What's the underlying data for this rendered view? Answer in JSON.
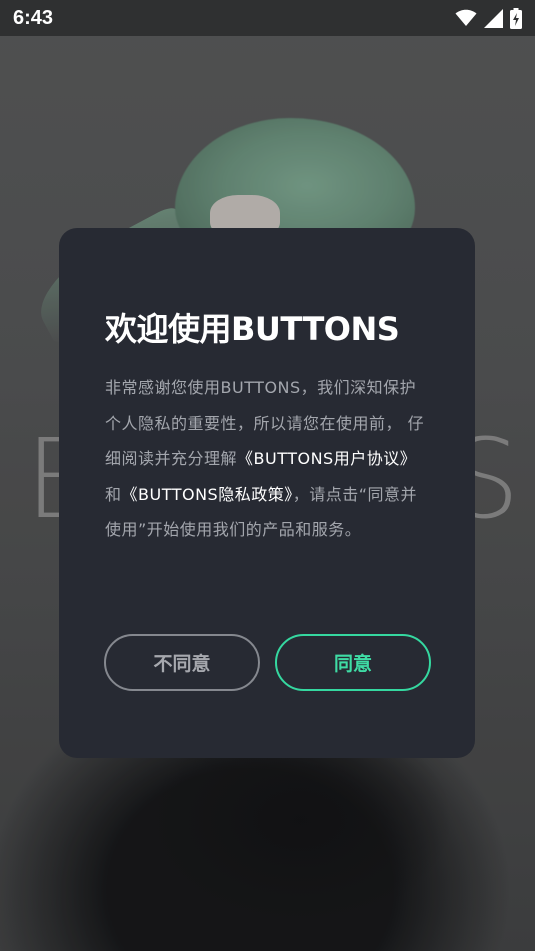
{
  "status_bar": {
    "time": "6:43",
    "icons": [
      "wifi-icon",
      "cellular-signal-icon",
      "battery-charging-icon"
    ]
  },
  "background": {
    "brand_letter_left": "B",
    "brand_letter_right": "S"
  },
  "dialog": {
    "title": "欢迎使用BUTTONS",
    "body": {
      "part1": "非常感谢您使用BUTTONS，我们深知保护个人隐私的重要性，所以请您在使用前， 仔细阅读并充分理解",
      "user_agreement_link": "《BUTTONS用户协议》",
      "connector": "和",
      "privacy_policy_link": "《BUTTONS隐私政策》",
      "part2": "，请点击“同意并使用”开始使用我们的产品和服务。"
    },
    "disagree_label": "不同意",
    "agree_label": "同意"
  },
  "colors": {
    "dialog_bg": "#272a33",
    "accent": "#35d8a0",
    "body_text": "#a3a6ad",
    "link_text": "#ffffff"
  }
}
